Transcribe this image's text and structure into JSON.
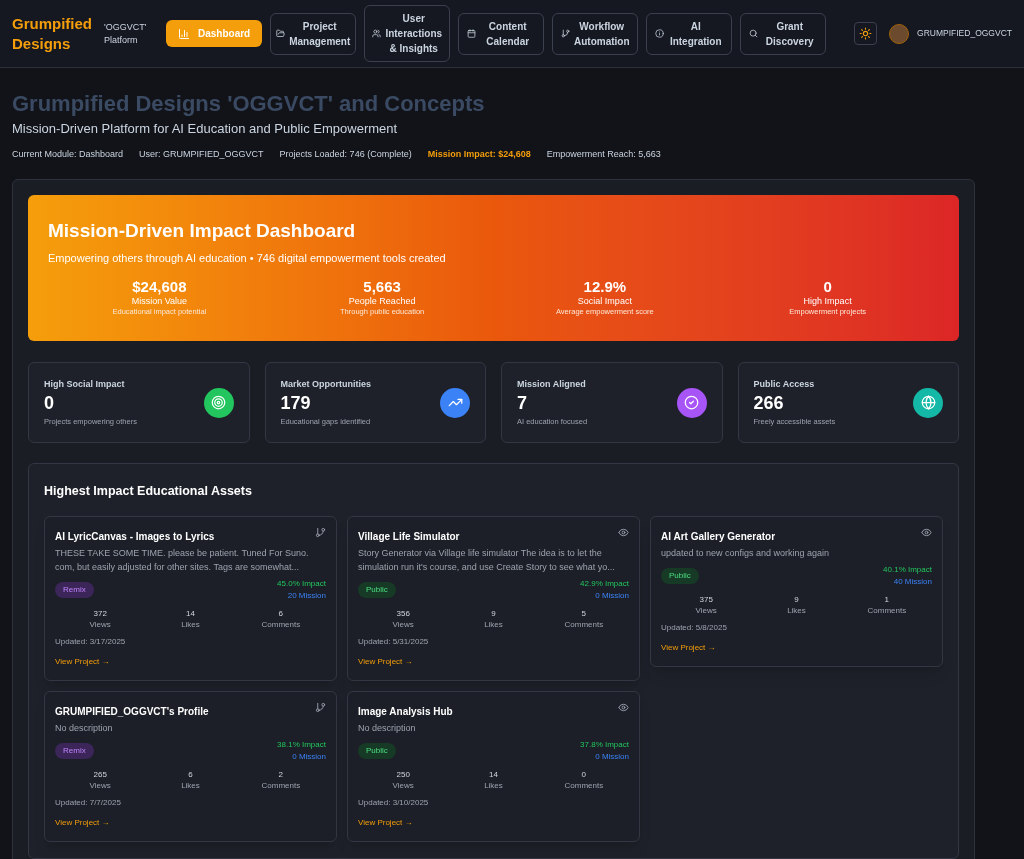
{
  "brand": {
    "name": "Grumpified Designs",
    "tagline": "'OGGVCT' Platform"
  },
  "nav": [
    {
      "label": "Dashboard",
      "selected": true
    },
    {
      "label": "Project Management",
      "selected": false
    },
    {
      "label": "User Interactions & Insights",
      "selected": false
    },
    {
      "label": "Content Calendar",
      "selected": false
    },
    {
      "label": "Workflow Automation",
      "selected": false
    },
    {
      "label": "AI Integration",
      "selected": false
    },
    {
      "label": "Grant Discovery",
      "selected": false
    }
  ],
  "user": {
    "name": "GRUMPIFIED_OGGVCT"
  },
  "page": {
    "title": "Grumpified Designs 'OGGVCT' and Concepts",
    "subtitle": "Mission-Driven Platform for AI Education and Public Empowerment"
  },
  "status": [
    {
      "text": "Current Module: Dashboard",
      "highlight": false
    },
    {
      "text": "User: GRUMPIFIED_OGGVCT",
      "highlight": false
    },
    {
      "text": "Projects Loaded: 746 (Complete)",
      "highlight": false
    },
    {
      "text": "Mission Impact: $24,608",
      "highlight": true
    },
    {
      "text": "Empowerment Reach: 5,663",
      "highlight": false
    }
  ],
  "hero": {
    "title": "Mission-Driven Impact Dashboard",
    "subtitle": "Empowering others through AI education • 746 digital empowerment tools created",
    "metrics": [
      {
        "value": "$24,608",
        "label": "Mission Value",
        "note": "Educational impact potential"
      },
      {
        "value": "5,663",
        "label": "People Reached",
        "note": "Through public education"
      },
      {
        "value": "12.9%",
        "label": "Social Impact",
        "note": "Average empowerment score"
      },
      {
        "value": "0",
        "label": "High Impact",
        "note": "Empowerment projects"
      }
    ]
  },
  "stats": [
    {
      "label": "High Social Impact",
      "value": "0",
      "note": "Projects empowering others",
      "color": "#22c55e"
    },
    {
      "label": "Market Opportunities",
      "value": "179",
      "note": "Educational gaps identified",
      "color": "#3b82f6"
    },
    {
      "label": "Mission Aligned",
      "value": "7",
      "note": "AI education focused",
      "color": "#a855f7"
    },
    {
      "label": "Public Access",
      "value": "266",
      "note": "Freely accessible assets",
      "color": "#14b8a6"
    }
  ],
  "assets": {
    "title": "Highest Impact Educational Assets",
    "projects": [
      {
        "kind": "remix",
        "title": "AI LyricCanvas - Images to Lyrics",
        "description": "THESE TAKE SOME TIME. please be patient. Tuned For Suno. com, but easily adjusted for other sites. Tags are somewhat...",
        "badge": "Remix",
        "impact": "45.0% Impact",
        "mission": "20 Mission",
        "stats": [
          {
            "value": "372",
            "label": "Views"
          },
          {
            "value": "14",
            "label": "Likes"
          },
          {
            "value": "6",
            "label": "Comments"
          }
        ],
        "updated": "Updated: 3/17/2025",
        "link": "View Project →"
      },
      {
        "kind": "public",
        "title": "Village Life Simulator",
        "description": "Story Generator via Village life simulator The idea is to let the simulation run it's course, and use Create Story to see what yo...",
        "badge": "Public",
        "impact": "42.9% Impact",
        "mission": "0 Mission",
        "stats": [
          {
            "value": "356",
            "label": "Views"
          },
          {
            "value": "9",
            "label": "Likes"
          },
          {
            "value": "5",
            "label": "Comments"
          }
        ],
        "updated": "Updated: 5/31/2025",
        "link": "View Project →"
      },
      {
        "kind": "public",
        "title": "AI Art Gallery Generator",
        "description": "updated to new configs and working again",
        "badge": "Public",
        "impact": "40.1% Impact",
        "mission": "40 Mission",
        "stats": [
          {
            "value": "375",
            "label": "Views"
          },
          {
            "value": "9",
            "label": "Likes"
          },
          {
            "value": "1",
            "label": "Comments"
          }
        ],
        "updated": "Updated: 5/8/2025",
        "link": "View Project →"
      },
      {
        "kind": "remix",
        "title": "GRUMPIFIED_OGGVCT's Profile",
        "description": "No description",
        "badge": "Remix",
        "impact": "38.1% Impact",
        "mission": "0 Mission",
        "stats": [
          {
            "value": "265",
            "label": "Views"
          },
          {
            "value": "6",
            "label": "Likes"
          },
          {
            "value": "2",
            "label": "Comments"
          }
        ],
        "updated": "Updated: 7/7/2025",
        "link": "View Project →"
      },
      {
        "kind": "public",
        "title": "Image Analysis Hub",
        "description": "No description",
        "badge": "Public",
        "impact": "37.8% Impact",
        "mission": "0 Mission",
        "stats": [
          {
            "value": "250",
            "label": "Views"
          },
          {
            "value": "14",
            "label": "Likes"
          },
          {
            "value": "0",
            "label": "Comments"
          }
        ],
        "updated": "Updated: 3/10/2025",
        "link": "View Project →"
      }
    ]
  }
}
